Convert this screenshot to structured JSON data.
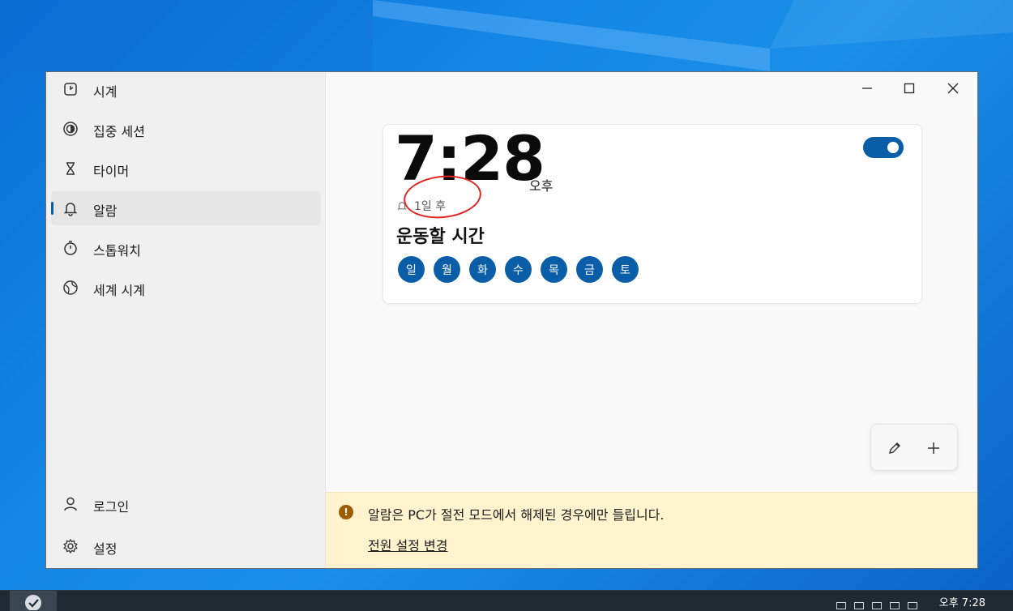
{
  "sidebar": {
    "items": [
      {
        "label": "시계",
        "icon": "clock-icon"
      },
      {
        "label": "집중 세션",
        "icon": "focus-session-icon"
      },
      {
        "label": "타이머",
        "icon": "hourglass-icon"
      },
      {
        "label": "알람",
        "icon": "bell-icon",
        "active": true
      },
      {
        "label": "스톱워치",
        "icon": "stopwatch-icon"
      },
      {
        "label": "세계 시계",
        "icon": "globe-icon"
      }
    ],
    "bottom": [
      {
        "label": "로그인",
        "icon": "person-icon"
      },
      {
        "label": "설정",
        "icon": "gear-icon"
      }
    ]
  },
  "window_controls": [
    "minimize-icon",
    "maximize-icon",
    "close-icon"
  ],
  "alarm": {
    "time": "7:28",
    "ampm": "오후",
    "remaining": "1일 후",
    "name": "운동할 시간",
    "days": [
      "일",
      "월",
      "화",
      "수",
      "목",
      "금",
      "토"
    ],
    "enabled": true
  },
  "actions": {
    "edit_icon": "pencil-icon",
    "add_icon": "plus-icon"
  },
  "notice": {
    "text": "알람은 PC가 절전 모드에서 해제된 경우에만 들립니다.",
    "link": "전원 설정 변경"
  },
  "taskbar": {
    "clock": "오후 7:28"
  },
  "colors": {
    "accent": "#0a5ea8",
    "notice_bg": "#fff4ce",
    "highlight": "#e02323"
  }
}
